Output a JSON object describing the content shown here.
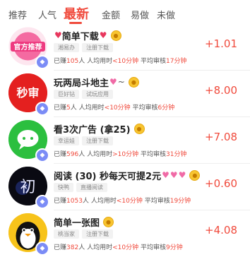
{
  "tabs": [
    "推荐",
    "人气",
    "最新",
    "金额",
    "易做",
    "未做"
  ],
  "tasks": [
    {
      "title": "简单下载",
      "tags": [
        "湘易办",
        "注册下载"
      ],
      "earned_count": "105",
      "time_text": "<10分钟",
      "review_text": "17分钟",
      "reward": "+1.01"
    },
    {
      "title": "玩两局斗地主",
      "tags": [
        "巨好钻",
        "试玩应用"
      ],
      "earned_count": "5",
      "time_text": "<10分钟",
      "review_text": "6分钟",
      "reward": "+8.00"
    },
    {
      "title": "看3次广告 (拿25)",
      "tags": [
        "幸运娃",
        "注册下载"
      ],
      "earned_count": "596",
      "time_text": ">10分钟",
      "review_text": "31分钟",
      "reward": "+7.08"
    },
    {
      "title": "阅读 (30) 秒每天可提2元",
      "tags": [
        "快鸭",
        "直播阅读"
      ],
      "earned_count": "1053",
      "time_text": "<10分钟",
      "review_text": "19分钟",
      "reward": "+0.60"
    },
    {
      "title": "简单一张图",
      "tags": [
        "桃当家",
        "注册下载"
      ],
      "earned_count": "382",
      "time_text": "<10分钟",
      "review_text": "9分钟",
      "reward": "+4.08"
    }
  ],
  "labels": {
    "earned_prefix": "已赚",
    "earned_suffix": "人",
    "avg_time": "人均用时",
    "avg_review": "平均审核"
  },
  "avatars": [
    {
      "text": "官方推荐",
      "icon": "official-recommend-icon"
    },
    {
      "text": "秒审",
      "icon": "instant-review-icon"
    },
    {
      "text": "",
      "icon": "chat-bubble-icon"
    },
    {
      "text": "初",
      "icon": "calligraphy-icon"
    },
    {
      "text": "",
      "icon": "penguin-icon"
    }
  ],
  "colors": {
    "accent": "#f04a3c",
    "badge": "#7b8cf6",
    "coin": "#f8c531"
  }
}
